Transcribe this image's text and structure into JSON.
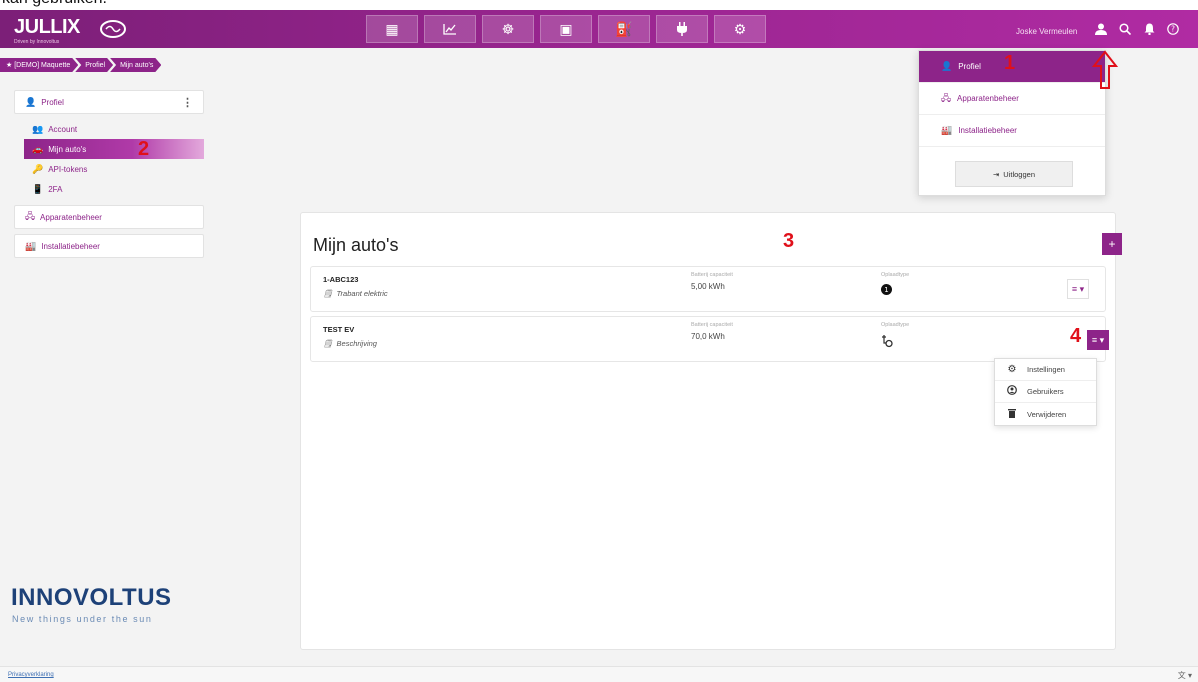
{
  "caption": "kan gebruiken.",
  "header": {
    "logo": "JULLIX",
    "logo_sub": "Driven by Innovoltus",
    "nav": [
      {
        "icon": "dashboard-icon",
        "glyph": "▦"
      },
      {
        "icon": "chart-icon",
        "glyph": "📈"
      },
      {
        "icon": "brain-icon",
        "glyph": "☸"
      },
      {
        "icon": "money-icon",
        "glyph": "▣"
      },
      {
        "icon": "fuel-icon",
        "glyph": "⛽"
      },
      {
        "icon": "plug-icon",
        "glyph": "⏚"
      },
      {
        "icon": "gear-icon",
        "glyph": "⚙"
      }
    ],
    "user_name": "Joske Vermeulen"
  },
  "breadcrumb": [
    "★  [DEMO] Maquette",
    "Profiel",
    "Mijn auto's"
  ],
  "sidebar": {
    "profiel": "Profiel",
    "sub_items": [
      {
        "label": "Account",
        "glyph": "👥"
      },
      {
        "label": "Mijn auto's",
        "glyph": "🚗"
      },
      {
        "label": "API-tokens",
        "glyph": "🔑"
      },
      {
        "label": "2FA",
        "glyph": "📱"
      }
    ],
    "apparatenbeheer": "Apparatenbeheer",
    "installatiebeheer": "Installatiebeheer"
  },
  "branding": {
    "name": "INNOVOLTUS",
    "tagline": "New things under the sun"
  },
  "main": {
    "title": "Mijn auto's",
    "add_label": "+",
    "cars": [
      {
        "name": "1-ABC123",
        "description": "Trabant elektric",
        "capacity_label": "Batterij capaciteit",
        "capacity": "5,00 kWh",
        "charge_label": "Oplaadtype"
      },
      {
        "name": "TEST EV",
        "description": "Beschrijving",
        "capacity_label": "Batterij capaciteit",
        "capacity": "70,0 kWh",
        "charge_label": "Oplaadtype"
      }
    ],
    "menu_label": "≡ ▾"
  },
  "car_menu": [
    "Instellingen",
    "Gebruikers",
    "Verwijderen"
  ],
  "profile_menu": {
    "items": [
      "Profiel",
      "Apparatenbeheer",
      "Installatiebeheer"
    ],
    "logout": "Uitloggen"
  },
  "annotations": [
    "1",
    "2",
    "3",
    "4"
  ],
  "footer": {
    "privacy": "Privacyverklaring",
    "right": "文 ▾"
  },
  "colors": {
    "brand": "#8d2489",
    "annotation": "#e0101a",
    "brand_blue": "#1d4178"
  }
}
